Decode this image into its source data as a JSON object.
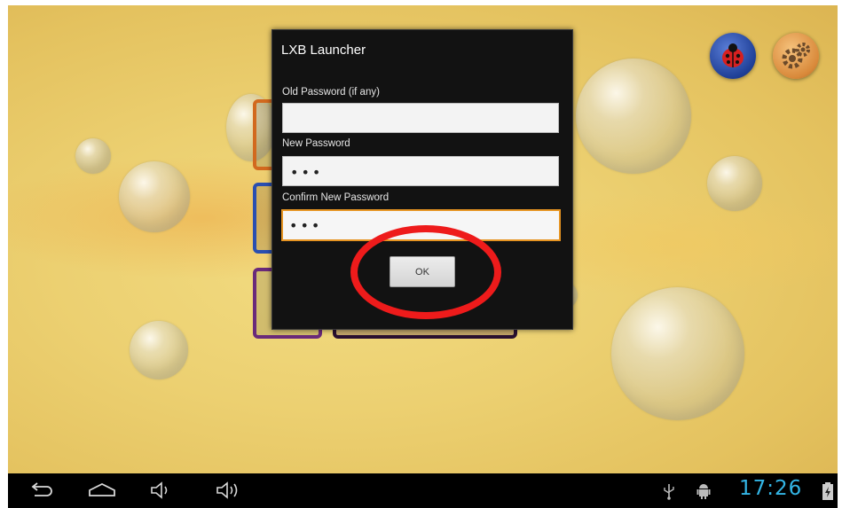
{
  "dialog": {
    "title": "LXB Launcher",
    "old_password": {
      "label": "Old Password (if any)",
      "value": ""
    },
    "new_password": {
      "label": "New Password",
      "value": "•••"
    },
    "confirm_password": {
      "label": "Confirm New Password",
      "value": "•••"
    },
    "ok_label": "OK"
  },
  "launcher": {
    "tile_colors": [
      "#d2691e",
      "#2a4fb0",
      "#6a2a7a"
    ],
    "top_icons": [
      "ladybug-icon",
      "settings-gears-icon"
    ]
  },
  "navbar": {
    "buttons": [
      "back-icon",
      "home-icon",
      "volume-down-icon",
      "volume-up-icon"
    ],
    "status_icons": [
      "usb-icon",
      "android-debug-icon",
      "battery-icon"
    ],
    "clock": "17:26",
    "clock_color": "#33b5e5"
  },
  "colors": {
    "focus_border": "#e69422",
    "highlight_ring": "#ee1b1b"
  }
}
